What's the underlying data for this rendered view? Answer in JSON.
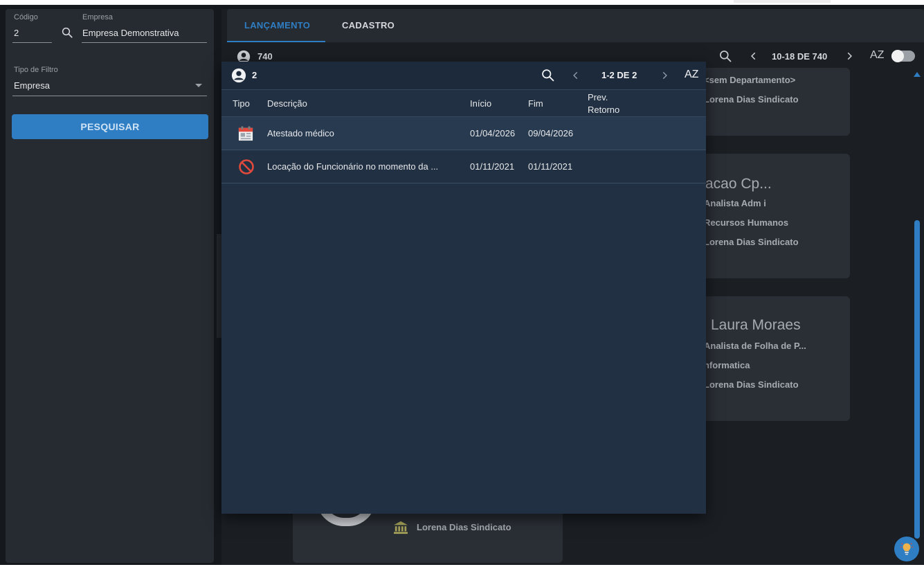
{
  "filters": {
    "codigo_label": "Código",
    "codigo_value": "2",
    "empresa_label": "Empresa",
    "empresa_value": "Empresa Demonstrativa",
    "tipo_filtro_label": "Tipo de Filtro",
    "tipo_filtro_value": "Empresa",
    "search_button": "PESQUISAR"
  },
  "tabs": [
    {
      "label": "LANÇAMENTO",
      "active": true
    },
    {
      "label": "CADASTRO",
      "active": false
    }
  ],
  "list_header": {
    "count": "740",
    "pagination": "10-18 DE 740",
    "sort_icon_text": "AZ"
  },
  "background_cards": [
    {
      "lines": [
        "<sem Departamento>",
        "Lorena Dias Sindicato"
      ]
    },
    {
      "name": "racao Cp...",
      "lines": [
        "Analista Adm i",
        "Recursos Humanos",
        "Lorena Dias Sindicato"
      ]
    },
    {
      "name": "Laura Moraes",
      "lines": [
        "Analista de Folha de P...",
        "nformatica",
        "Lorena Dias Sindicato"
      ]
    },
    {
      "lines": [
        "Lorena Dias Sindicato"
      ]
    }
  ],
  "dialog": {
    "count": "2",
    "pagination": "1-2 DE 2",
    "sort_icon_text": "AZ",
    "columns": {
      "tipo": "Tipo",
      "descricao": "Descrição",
      "inicio": "Início",
      "fim": "Fim",
      "prev_retorno_1": "Prev.",
      "prev_retorno_2": "Retorno"
    },
    "rows": [
      {
        "icon": "calendar-icon",
        "descricao": "Atestado médico",
        "inicio": "01/04/2026",
        "fim": "09/04/2026",
        "prev_retorno": ""
      },
      {
        "icon": "block-icon",
        "descricao": "Locação do Funcionário no momento da ...",
        "inicio": "01/11/2021",
        "fim": "01/11/2021",
        "prev_retorno": ""
      }
    ]
  },
  "colors": {
    "accent": "#2f7ec4",
    "dialog_bg": "#213043",
    "block_red": "#e0493b"
  }
}
